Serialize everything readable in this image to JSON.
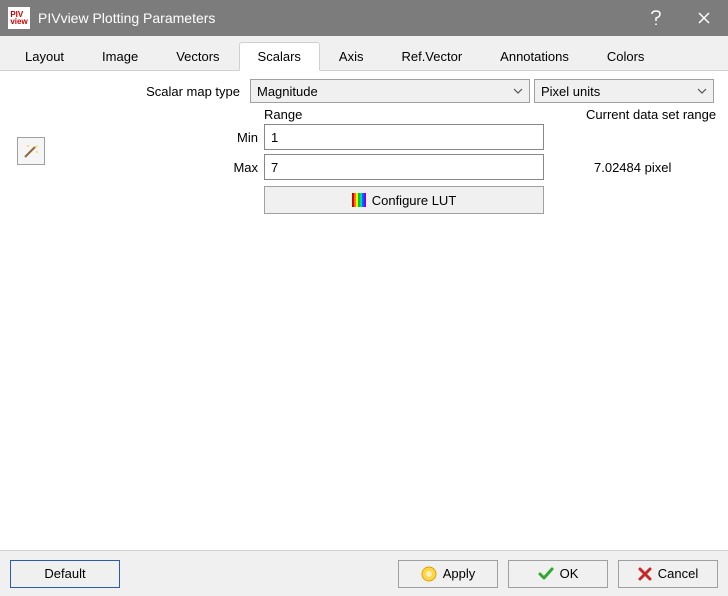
{
  "window": {
    "title": "PIVview Plotting Parameters"
  },
  "tabs": [
    "Layout",
    "Image",
    "Vectors",
    "Scalars",
    "Axis",
    "Ref.Vector",
    "Annotations",
    "Colors"
  ],
  "active_tab": "Scalars",
  "labels": {
    "scalar_map_type": "Scalar map type",
    "range": "Range",
    "current_range": "Current data set range",
    "min": "Min",
    "max": "Max",
    "configure_lut": "Configure LUT"
  },
  "combos": {
    "scalar_type": "Magnitude",
    "units": "Pixel units"
  },
  "fields": {
    "min": "1",
    "max": "7"
  },
  "current_range_value": "7.02484 pixel",
  "buttons": {
    "default": "Default",
    "apply": "Apply",
    "ok": "OK",
    "cancel": "Cancel"
  }
}
